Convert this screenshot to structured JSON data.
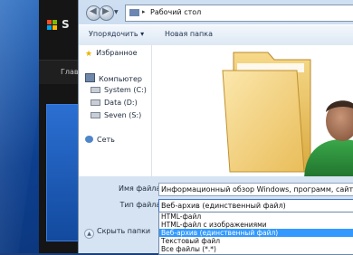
{
  "background_app": {
    "brand": "S",
    "menu_item": "Глав"
  },
  "dialog": {
    "address": {
      "path": "Рабочий стол",
      "separator": "▸"
    },
    "nav": {
      "back_glyph": "◀",
      "forward_glyph": "▶",
      "dropdown_glyph": "▼"
    },
    "toolbar": {
      "organize": "Упорядочить ▾",
      "new_folder": "Новая папка"
    },
    "sidebar": {
      "favorites": "Избранное",
      "computer": "Компьютер",
      "drives": [
        "System (C:)",
        "Data (D:)",
        "Seven (S:)"
      ],
      "network": "Сеть"
    },
    "form": {
      "filename_label": "Имя файла:",
      "filename_value": "Информационный обзор Windows, программ, сайтов и",
      "filetype_label": "Тип файла:",
      "filetype_value": "Веб-архив (единственный файл)",
      "options": [
        "HTML-файл",
        "HTML-файл с изображениями",
        "Веб-архив (единственный файл)",
        "Текстовый файл",
        "Все файлы (*.*)"
      ],
      "selected_index": 2,
      "hide_folders": "Скрыть папки",
      "hide_glyph": "▲"
    }
  },
  "colors": {
    "selection": "#3399ff",
    "dialog_bg": "#cfdff2",
    "desktop": "#1a4fa0"
  }
}
